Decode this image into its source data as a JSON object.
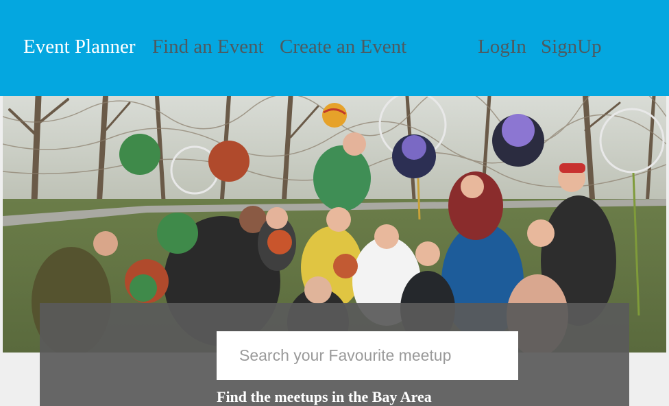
{
  "navbar": {
    "brand": "Event Planner",
    "links": {
      "find": "Find an Event",
      "create": "Create an Event",
      "login": "LogIn",
      "signup": "SignUp"
    },
    "colors": {
      "background": "#04a7e0",
      "brand": "#ffffff",
      "link": "#4d5a60"
    }
  },
  "hero": {
    "image_subject": "group-photo-outdoor-park"
  },
  "search": {
    "placeholder": "Search your Favourite meetup",
    "value": ""
  },
  "tagline": "Find the meetups in the Bay Area"
}
